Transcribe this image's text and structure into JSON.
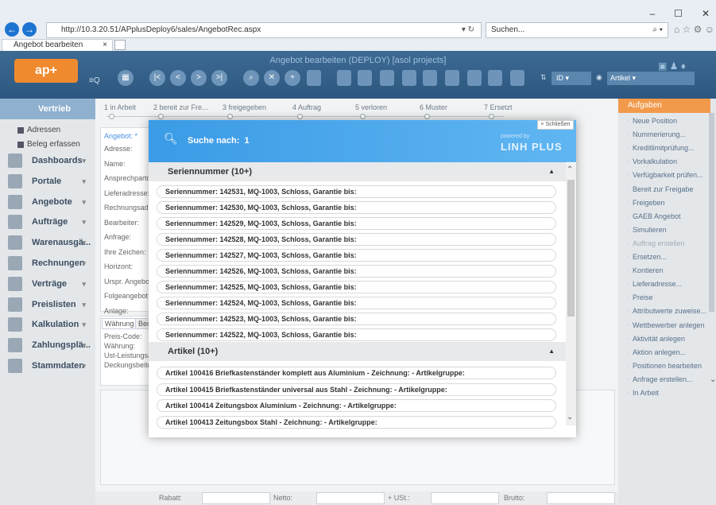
{
  "browser": {
    "url": "http://10.3.20.51/APplusDeploy6/sales/AngebotRec.aspx",
    "search_placeholder": "Suchen...",
    "tab_title": "Angebot bearbeiten",
    "tab_close": "×"
  },
  "app": {
    "title": "Angebot bearbeiten (DEPLOY) [asol projects]",
    "logo_text": "ap+",
    "sort_field": "ID",
    "search_type": "Artikel"
  },
  "steps": [
    "1 in Arbeit",
    "2 bereit zur Fre...",
    "3 freigegeben",
    "4 Auftrag",
    "5 verloren",
    "6 Muster",
    "7 Ersetzt"
  ],
  "sidebar": {
    "selected": "Vertrieb",
    "subitems": [
      "Adressen",
      "Beleg erfassen"
    ],
    "items": [
      "Dashboards",
      "Portale",
      "Angebote",
      "Aufträge",
      "Warenausgä...",
      "Rechnungen",
      "Verträge",
      "Preislisten",
      "Kalkulation",
      "Zahlungsplä...",
      "Stammdaten"
    ]
  },
  "form": {
    "header": "Angebot: *",
    "labels": [
      "Adresse:",
      "Name:",
      "Ansprechpartn",
      "Lieferadresse:",
      "Rechnungsadr",
      "Bearbeiter:",
      "Anfrage:",
      "Ihre Zeichen:",
      "Horizont:",
      "Urspr. Angebot",
      "Folgeangebot:",
      "Anlage:"
    ],
    "tab_labels": [
      "Währung",
      "Bed"
    ],
    "labels2": [
      "Preis-Code:",
      "Währung:",
      "Ust-Leistungsa",
      "Deckungsbeitra"
    ]
  },
  "footer": {
    "rabatt": "Rabatt:",
    "netto": "Netto:",
    "ust": "+ USt.:",
    "brutto": "Brutto:"
  },
  "tasks": {
    "title": "Aufgaben",
    "items": [
      "Neue Position",
      "Nummerierung...",
      "Kreditlimitprüfung...",
      "Vorkalkulation",
      "Verfügbarkeit prüfen...",
      "Bereit zur Freigabe",
      "Freigeben",
      "GAEB Angebot",
      "Simulieren",
      "Auftrag erstellen",
      "Ersetzen...",
      "Kontieren",
      "Lieferadresse...",
      "Preise",
      "Attributwerte zuweise...",
      "Wettbewerber anlegen",
      "Aktivität anlegen",
      "Aktion anlegen...",
      "Positionen bearbeiten",
      "Anfrage erstellen...",
      "In Arbeit"
    ]
  },
  "modal": {
    "close_label": "× Schließen",
    "search_label": "Suche nach:",
    "search_term": "1",
    "powered_by": "powered by",
    "brand": "LINH PLUS",
    "group1": "Seriennummer (10+)",
    "rows1": [
      "Seriennummer: 142531, MQ-1003, Schloss, Garantie bis:",
      "Seriennummer: 142530, MQ-1003, Schloss, Garantie bis:",
      "Seriennummer: 142529, MQ-1003, Schloss, Garantie bis:",
      "Seriennummer: 142528, MQ-1003, Schloss, Garantie bis:",
      "Seriennummer: 142527, MQ-1003, Schloss, Garantie bis:",
      "Seriennummer: 142526, MQ-1003, Schloss, Garantie bis:",
      "Seriennummer: 142525, MQ-1003, Schloss, Garantie bis:",
      "Seriennummer: 142524, MQ-1003, Schloss, Garantie bis:",
      "Seriennummer: 142523, MQ-1003, Schloss, Garantie bis:",
      "Seriennummer: 142522, MQ-1003, Schloss, Garantie bis:"
    ],
    "group2": "Artikel (10+)",
    "rows2": [
      "Artikel 100416 Briefkastenständer komplett aus Aluminium - Zeichnung: - Artikelgruppe:",
      "Artikel 100415 Briefkastenständer universal aus Stahl - Zeichnung: - Artikelgruppe:",
      "Artikel 100414 Zeitungsbox Aluminium - Zeichnung: - Artikelgruppe:",
      "Artikel 100413 Zeitungsbox Stahl - Zeichnung: - Artikelgruppe:"
    ]
  }
}
